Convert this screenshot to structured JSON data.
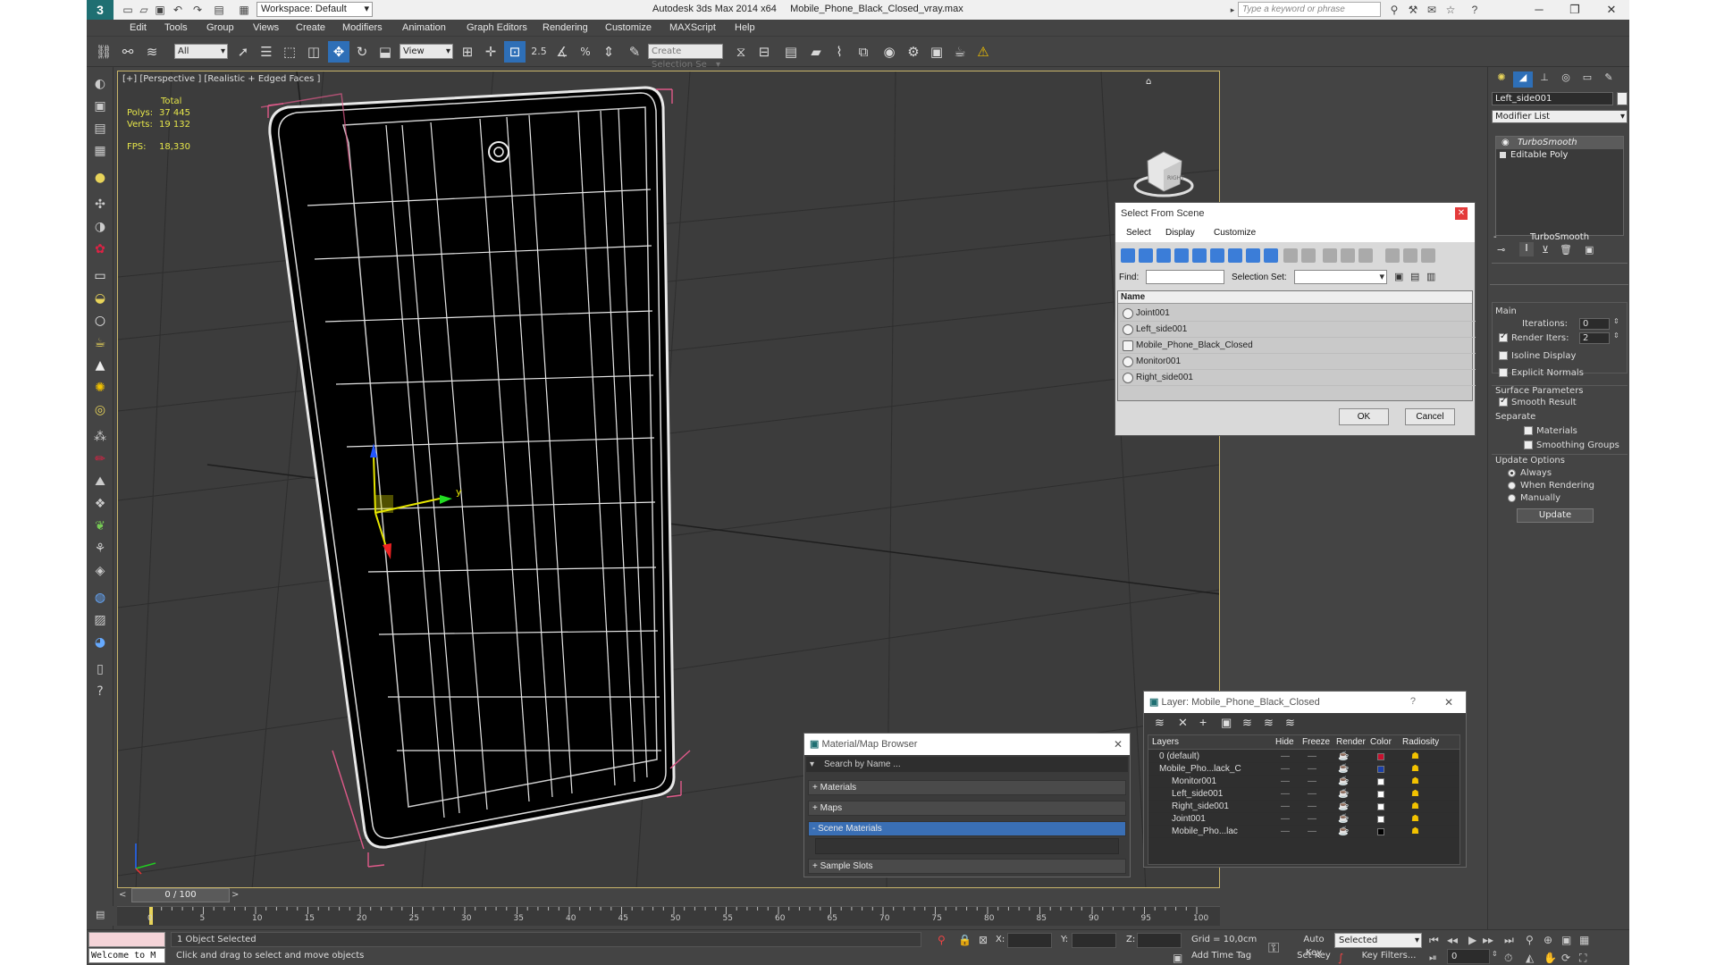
{
  "app": {
    "title": "Autodesk 3ds Max  2014 x64",
    "file": "Mobile_Phone_Black_Closed_vray.max",
    "workspace": "Workspace: Default",
    "search_placeholder": "Type a keyword or phrase",
    "logo": "3"
  },
  "menu": [
    "Edit",
    "Tools",
    "Group",
    "Views",
    "Create",
    "Modifiers",
    "Animation",
    "Graph Editors",
    "Rendering",
    "Customize",
    "MAXScript",
    "Help"
  ],
  "toolbar": {
    "selection_filter": "All",
    "ref_coord": "View",
    "named_selection_placeholder": "Create Selection Se",
    "snap_label": "2.5"
  },
  "viewport": {
    "label": "[+] [Perspective ] [Realistic + Edged Faces ]",
    "stats": {
      "total_label": "Total",
      "polys_label": "Polys:",
      "polys_value": "37 445",
      "verts_label": "Verts:",
      "verts_value": "19 132",
      "fps_label": "FPS:",
      "fps_value": "18,330"
    },
    "gizmo_y": "y"
  },
  "select_from_scene": {
    "title": "Select From Scene",
    "tabs": [
      "Select",
      "Display",
      "Customize"
    ],
    "find_label": "Find:",
    "selection_set_label": "Selection Set:",
    "column_name": "Name",
    "items": [
      "Joint001",
      "Left_side001",
      "Mobile_Phone_Black_Closed",
      "Monitor001",
      "Right_side001"
    ],
    "ok": "OK",
    "cancel": "Cancel"
  },
  "material_browser": {
    "title": "Material/Map Browser",
    "search": "Search by Name ...",
    "sections": [
      "+ Materials",
      "+ Maps",
      "- Scene Materials",
      "+ Sample Slots"
    ]
  },
  "layer_dialog": {
    "title": "Layer: Mobile_Phone_Black_Closed",
    "help": "?",
    "columns": [
      "Layers",
      "Hide",
      "Freeze",
      "Render",
      "Color",
      "Radiosity"
    ],
    "rows": [
      {
        "name": "0 (default)",
        "indent": 1,
        "color": "#c8102e"
      },
      {
        "name": "Mobile_Pho...lack_C",
        "indent": 1,
        "color": "#1a3fa8"
      },
      {
        "name": "Monitor001",
        "indent": 2,
        "color": "#ffffff"
      },
      {
        "name": "Left_side001",
        "indent": 2,
        "color": "#ffffff"
      },
      {
        "name": "Right_side001",
        "indent": 2,
        "color": "#ffffff"
      },
      {
        "name": "Joint001",
        "indent": 2,
        "color": "#ffffff"
      },
      {
        "name": "Mobile_Pho...lac",
        "indent": 2,
        "color": "#000000"
      }
    ]
  },
  "command_panel": {
    "object_name": "Left_side001",
    "modifier_list": "Modifier List",
    "stack": [
      "TurboSmooth",
      "Editable Poly"
    ],
    "rollout_title": "TurboSmooth",
    "main_label": "Main",
    "iterations_label": "Iterations:",
    "iterations_value": "0",
    "render_iters_label": "Render Iters:",
    "render_iters_value": "2",
    "isoline": "Isoline Display",
    "explicit_normals": "Explicit Normals",
    "surface_params": "Surface Parameters",
    "smooth_result": "Smooth Result",
    "separate": "Separate",
    "materials": "Materials",
    "smoothing_groups": "Smoothing Groups",
    "update_options": "Update Options",
    "always": "Always",
    "when_rendering": "When Rendering",
    "manually": "Manually",
    "update": "Update"
  },
  "timeline": {
    "frame_label": "0 / 100",
    "ticks": [
      "0",
      "5",
      "10",
      "15",
      "20",
      "25",
      "30",
      "35",
      "40",
      "45",
      "50",
      "55",
      "60",
      "65",
      "70",
      "75",
      "80",
      "85",
      "90",
      "95",
      "100"
    ]
  },
  "status": {
    "maxscript_text": "Welcome to M",
    "selection_text": "1 Object Selected",
    "prompt": "Click and drag to select and move objects",
    "x_label": "X:",
    "y_label": "Y:",
    "z_label": "Z:",
    "grid": "Grid = 10,0cm",
    "auto_key": "Auto Key",
    "selected": "Selected",
    "set_key": "Set Key",
    "key_filters": "Key Filters...",
    "add_time_tag": "Add Time Tag",
    "frame": "0"
  }
}
